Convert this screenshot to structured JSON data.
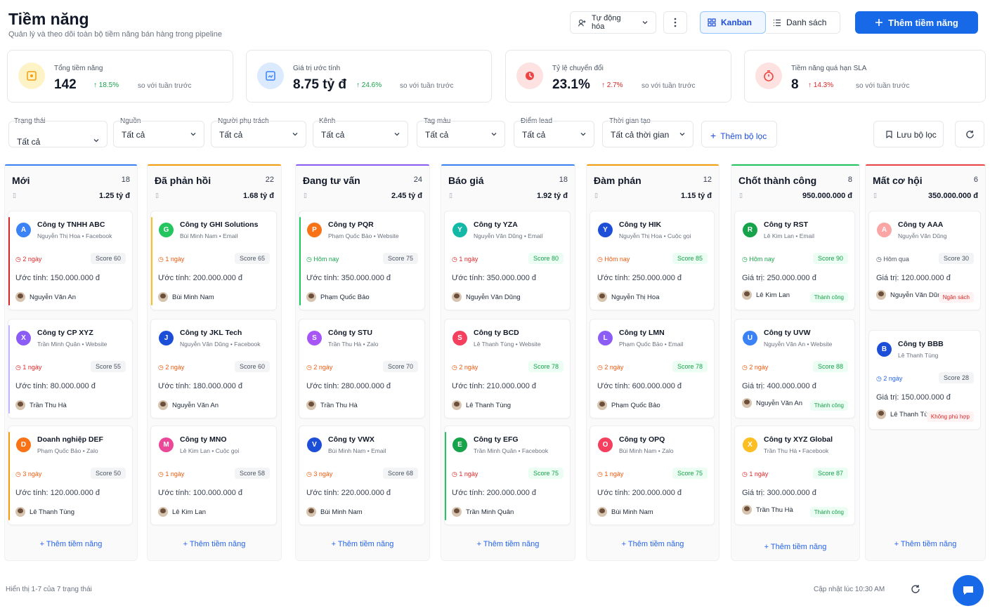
{
  "header": {
    "title": "Tiềm năng",
    "subtitle": "Quản lý và theo dõi toàn bộ tiềm năng bán hàng trong pipeline",
    "automation_label": "Tự động hóa",
    "view_kanban": "Kanban",
    "view_list": "Danh sách",
    "add_label": "Thêm tiềm năng"
  },
  "stats": [
    {
      "label": "Tổng tiềm năng",
      "value": "142",
      "change": "18.5%",
      "direction": "up",
      "compare": "so với tuần trước",
      "color": "#f59e0b"
    },
    {
      "label": "Giá trị ước tính",
      "value": "8.75 tỷ đ",
      "change": "24.6%",
      "direction": "up",
      "compare": "so với tuần trước",
      "color": "#3b82f6"
    },
    {
      "label": "Tỷ lệ chuyển đổi",
      "value": "23.1%",
      "change": "2.7%",
      "direction": "up-red",
      "compare": "so với tuần trước",
      "color": "#ef4444"
    },
    {
      "label": "Tiềm năng quá hạn SLA",
      "value": "8",
      "change": "14.3%",
      "direction": "up-red",
      "compare": "so với tuần trước",
      "color": "#ef4444"
    }
  ],
  "filters": [
    {
      "label": "Trạng thái",
      "value": "Tất cả"
    },
    {
      "label": "Nguồn",
      "value": "Tất cả"
    },
    {
      "label": "Người phụ trách",
      "value": "Tất cả"
    },
    {
      "label": "Kênh",
      "value": "Tất cả"
    },
    {
      "label": "Tag màu",
      "value": "Tất cả"
    },
    {
      "label": "Điểm lead",
      "value": "Tất cả"
    },
    {
      "label": "Thời gian tạo",
      "value": "Tất cả thời gian"
    }
  ],
  "filter_actions": {
    "add_filter": "Thêm bộ lọc",
    "save_filter": "Lưu bộ lọc"
  },
  "columns": [
    {
      "name": "Mới",
      "count": "18",
      "sum": "1.25 tỷ đ",
      "color": "#3b82f6",
      "add": "Thêm tiềm năng",
      "cards": [
        {
          "initial": "A",
          "avatar_color": "#3b82f6",
          "company": "Công ty TNHH ABC",
          "owner_meta": "Nguyễn Thị Hoa",
          "source": "Facebook",
          "due": "2 ngày",
          "due_color": "#dc2626",
          "score": "Score 60",
          "score_green": false,
          "value_label": "Ước tính:",
          "value": "150.000.000 đ",
          "assignee": "Nguyễn Văn An",
          "accent": "#dc2626",
          "tag": ""
        },
        {
          "initial": "X",
          "avatar_color": "#8b5cf6",
          "company": "Công ty CP XYZ",
          "owner_meta": "Trần Minh Quân",
          "source": "Website",
          "due": "1 ngày",
          "due_color": "#dc2626",
          "score": "Score 55",
          "score_green": false,
          "value_label": "Ước tính:",
          "value": "80.000.000 đ",
          "assignee": "Trần Thu Hà",
          "accent": "#c4b5fd",
          "tag": ""
        },
        {
          "initial": "D",
          "avatar_color": "#f97316",
          "company": "Doanh nghiệp DEF",
          "owner_meta": "Phạm Quốc Bảo",
          "source": "Zalo",
          "due": "3 ngày",
          "due_color": "#ea580c",
          "score": "Score 50",
          "score_green": false,
          "value_label": "Ước tính:",
          "value": "120.000.000 đ",
          "assignee": "Lê Thanh Tùng",
          "accent": "#f59e0b",
          "tag": ""
        }
      ]
    },
    {
      "name": "Đã phản hồi",
      "count": "22",
      "sum": "1.68 tỷ đ",
      "color": "#f59e0b",
      "add": "Thêm tiềm năng",
      "cards": [
        {
          "initial": "G",
          "avatar_color": "#22c55e",
          "company": "Công ty GHI Solutions",
          "owner_meta": "Bùi Minh Nam",
          "source": "Email",
          "due": "1 ngày",
          "due_color": "#ea580c",
          "score": "Score 65",
          "score_green": false,
          "value_label": "Ước tính:",
          "value": "200.000.000 đ",
          "assignee": "Bùi Minh Nam",
          "accent": "#fbbf24",
          "tag": ""
        },
        {
          "initial": "J",
          "avatar_color": "#1d4ed8",
          "company": "Công ty JKL Tech",
          "owner_meta": "Nguyễn Văn Dũng",
          "source": "Facebook",
          "due": "2 ngày",
          "due_color": "#ea580c",
          "score": "Score 60",
          "score_green": false,
          "value_label": "Ước tính:",
          "value": "180.000.000 đ",
          "assignee": "Nguyễn Văn An",
          "accent": "",
          "tag": ""
        },
        {
          "initial": "M",
          "avatar_color": "#ec4899",
          "company": "Công ty MNO",
          "owner_meta": "Lê Kim Lan",
          "source": "Cuộc gọi",
          "due": "1 ngày",
          "due_color": "#ea580c",
          "score": "Score 58",
          "score_green": false,
          "value_label": "Ước tính:",
          "value": "100.000.000 đ",
          "assignee": "Lê Kim Lan",
          "accent": "",
          "tag": ""
        }
      ]
    },
    {
      "name": "Đang tư vấn",
      "count": "24",
      "sum": "2.45 tỷ đ",
      "color": "#8b5cf6",
      "add": "Thêm tiềm năng",
      "cards": [
        {
          "initial": "P",
          "avatar_color": "#f97316",
          "company": "Công ty PQR",
          "owner_meta": "Phạm Quốc Bảo",
          "source": "Website",
          "due": "Hôm nay",
          "due_color": "#16a34a",
          "score": "Score 75",
          "score_green": false,
          "value_label": "Ước tính:",
          "value": "350.000.000 đ",
          "assignee": "Phạm Quốc Bảo",
          "accent": "#22c55e",
          "tag": ""
        },
        {
          "initial": "S",
          "avatar_color": "#a855f7",
          "company": "Công ty STU",
          "owner_meta": "Trần Thu Hà",
          "source": "Zalo",
          "due": "2 ngày",
          "due_color": "#ea580c",
          "score": "Score 70",
          "score_green": false,
          "value_label": "Ước tính:",
          "value": "280.000.000 đ",
          "assignee": "Trần Thu Hà",
          "accent": "",
          "tag": ""
        },
        {
          "initial": "V",
          "avatar_color": "#1d4ed8",
          "company": "Công ty VWX",
          "owner_meta": "Bùi Minh Nam",
          "source": "Email",
          "due": "3 ngày",
          "due_color": "#ea580c",
          "score": "Score 68",
          "score_green": false,
          "value_label": "Ước tính:",
          "value": "220.000.000 đ",
          "assignee": "Bùi Minh Nam",
          "accent": "",
          "tag": ""
        }
      ]
    },
    {
      "name": "Báo giá",
      "count": "18",
      "sum": "1.92 tỷ đ",
      "color": "#3b82f6",
      "add": "Thêm tiềm năng",
      "cards": [
        {
          "initial": "Y",
          "avatar_color": "#14b8a6",
          "company": "Công ty YZA",
          "owner_meta": "Nguyễn Văn Dũng",
          "source": "Email",
          "due": "1 ngày",
          "due_color": "#dc2626",
          "score": "Score 80",
          "score_green": true,
          "value_label": "Ước tính:",
          "value": "350.000.000 đ",
          "assignee": "Nguyễn Văn Dũng",
          "accent": "",
          "tag": ""
        },
        {
          "initial": "S",
          "avatar_color": "#f43f5e",
          "company": "Công ty BCD",
          "owner_meta": "Lê Thanh Tùng",
          "source": "Website",
          "due": "2 ngày",
          "due_color": "#ea580c",
          "score": "Score 78",
          "score_green": true,
          "value_label": "Ước tính:",
          "value": "210.000.000 đ",
          "assignee": "Lê Thanh Tùng",
          "accent": "",
          "tag": ""
        },
        {
          "initial": "E",
          "avatar_color": "#16a34a",
          "company": "Công ty EFG",
          "owner_meta": "Trần Minh Quân",
          "source": "Facebook",
          "due": "1 ngày",
          "due_color": "#dc2626",
          "score": "Score 75",
          "score_green": true,
          "value_label": "Ước tính:",
          "value": "200.000.000 đ",
          "assignee": "Trần Minh Quân",
          "accent": "#22c55e",
          "tag": ""
        }
      ]
    },
    {
      "name": "Đàm phán",
      "count": "12",
      "sum": "1.15 tỷ đ",
      "color": "#f59e0b",
      "add": "Thêm tiềm năng",
      "cards": [
        {
          "initial": "Y",
          "avatar_color": "#1d4ed8",
          "company": "Công ty HIK",
          "owner_meta": "Nguyễn Thị Hoa",
          "source": "Cuộc gọi",
          "due": "Hôm nay",
          "due_color": "#ea580c",
          "score": "Score 85",
          "score_green": true,
          "value_label": "Ước tính:",
          "value": "250.000.000 đ",
          "assignee": "Nguyễn Thị Hoa",
          "accent": "",
          "tag": ""
        },
        {
          "initial": "L",
          "avatar_color": "#8b5cf6",
          "company": "Công ty LMN",
          "owner_meta": "Phạm Quốc Bảo",
          "source": "Email",
          "due": "2 ngày",
          "due_color": "#ea580c",
          "score": "Score 78",
          "score_green": true,
          "value_label": "Ước tính:",
          "value": "600.000.000 đ",
          "assignee": "Phạm Quốc Bảo",
          "accent": "",
          "tag": ""
        },
        {
          "initial": "O",
          "avatar_color": "#f43f5e",
          "company": "Công ty OPQ",
          "owner_meta": "Bùi Minh Nam",
          "source": "Zalo",
          "due": "1 ngày",
          "due_color": "#ea580c",
          "score": "Score 75",
          "score_green": true,
          "value_label": "Ước tính:",
          "value": "200.000.000 đ",
          "assignee": "Bùi Minh Nam",
          "accent": "",
          "tag": ""
        }
      ]
    },
    {
      "name": "Chốt thành công",
      "count": "8",
      "sum": "950.000.000 đ",
      "color": "#22c55e",
      "add": "Thêm tiềm năng",
      "cards": [
        {
          "initial": "R",
          "avatar_color": "#16a34a",
          "company": "Công ty RST",
          "owner_meta": "Lê Kim Lan",
          "source": "Email",
          "due": "Hôm nay",
          "due_color": "#16a34a",
          "score": "Score 90",
          "score_green": true,
          "value_label": "Giá trị:",
          "value": "250.000.000 đ",
          "assignee": "Lê Kim Lan",
          "accent": "",
          "tag": "Thành công",
          "tag_type": "win"
        },
        {
          "initial": "U",
          "avatar_color": "#3b82f6",
          "company": "Công ty UVW",
          "owner_meta": "Nguyễn Văn An",
          "source": "Website",
          "due": "2 ngày",
          "due_color": "#ea580c",
          "score": "Score 88",
          "score_green": true,
          "value_label": "Giá trị:",
          "value": "400.000.000 đ",
          "assignee": "Nguyễn Văn An",
          "accent": "",
          "tag": "Thành công",
          "tag_type": "win"
        },
        {
          "initial": "X",
          "avatar_color": "#fbbf24",
          "company": "Công ty XYZ Global",
          "owner_meta": "Trần Thu Hà",
          "source": "Facebook",
          "due": "1 ngày",
          "due_color": "#dc2626",
          "score": "Score 87",
          "score_green": true,
          "value_label": "Giá trị:",
          "value": "300.000.000 đ",
          "assignee": "Trần Thu Hà",
          "accent": "",
          "tag": "Thành công",
          "tag_type": "win"
        }
      ]
    },
    {
      "name": "Mất cơ hội",
      "count": "6",
      "sum": "350.000.000 đ",
      "color": "#ef4444",
      "add": "Thêm tiềm năng",
      "cards": [
        {
          "initial": "A",
          "avatar_color": "#fca5a5",
          "company": "Công ty AAA",
          "owner_meta": "Nguyễn Văn Dũng",
          "source": "",
          "due": "Hôm qua",
          "due_color": "#4b5563",
          "score": "Score 30",
          "score_green": false,
          "value_label": "Giá trị:",
          "value": "120.000.000 đ",
          "assignee": "Nguyễn Văn Dũng",
          "accent": "",
          "tag": "Ngân sách",
          "tag_type": "lost"
        },
        {
          "initial": "B",
          "avatar_color": "#1d4ed8",
          "company": "Công ty BBB",
          "owner_meta": "Lê Thanh Tùng",
          "source": "",
          "due": "2 ngày",
          "due_color": "#2563eb",
          "score": "Score 28",
          "score_green": false,
          "value_label": "Giá trị:",
          "value": "150.000.000 đ",
          "assignee": "Lê Thanh Tùng",
          "accent": "",
          "tag": "Không phù hợp",
          "tag_type": "lost"
        }
      ]
    }
  ],
  "footer": {
    "showing": "Hiển thị 1-7 của 7 trạng thái",
    "updated": "Cập nhật lúc 10:30 AM"
  }
}
